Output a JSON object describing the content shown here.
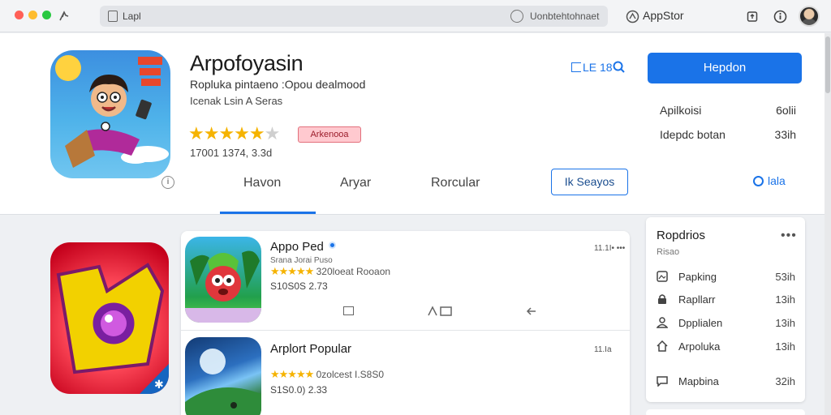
{
  "titlebar": {
    "address_left": "Lapl",
    "address_right": "Uonbtehtohnaet",
    "store_label": "AppStor"
  },
  "app": {
    "title": "Arpofoyasin",
    "subtitle": "Ropluka pintaeno :Opou dealmood",
    "developer": "Icenak Lsin A Seras",
    "rating_stars": 5,
    "rating_filled": 4.5,
    "badge": "Arkenooa",
    "meta": "17001 1374, 3.3d",
    "top_action": "LE 18",
    "get_button": "Hepdon",
    "info": [
      {
        "label": "Apilkoisi",
        "value": "6olii"
      },
      {
        "label": "Idepdc botan",
        "value": "33ih"
      }
    ]
  },
  "tabs": [
    {
      "label": "Havon",
      "active": true
    },
    {
      "label": "Aryar",
      "active": false
    },
    {
      "label": "Rorcular",
      "active": false
    }
  ],
  "outline_button": "Ik Seayos",
  "right_link": "lala",
  "list": [
    {
      "title": "Appo Ped",
      "subtitle": "Srana Jorai  Puso",
      "reviews": "320loeat Rooaon",
      "price": "S10S0S 2.73",
      "date": "11.1I• •••",
      "verified": true
    },
    {
      "title": "Arplort Popular",
      "subtitle": "",
      "reviews": "0zolcest I.S8S0",
      "price": "S1S0.0) 2.33",
      "date": "11.Ia",
      "verified": false
    }
  ],
  "side_panel": {
    "title": "Ropdrios",
    "subtitle": "Risao",
    "more": "•••",
    "rows": [
      {
        "icon": "image-icon",
        "label": "Papking",
        "value": "53ih"
      },
      {
        "icon": "lock-icon",
        "label": "Rapllarr",
        "value": "13ih"
      },
      {
        "icon": "person-icon",
        "label": "Dpplialen",
        "value": "13ih"
      },
      {
        "icon": "home-icon",
        "label": "Arpoluka",
        "value": "13ih"
      },
      {
        "icon": "chat-icon",
        "label": "Mapbina",
        "value": "32ih"
      }
    ]
  },
  "colors": {
    "accent": "#1a73e8",
    "star": "#f5b301",
    "badge_bg": "#ffc9cf"
  }
}
